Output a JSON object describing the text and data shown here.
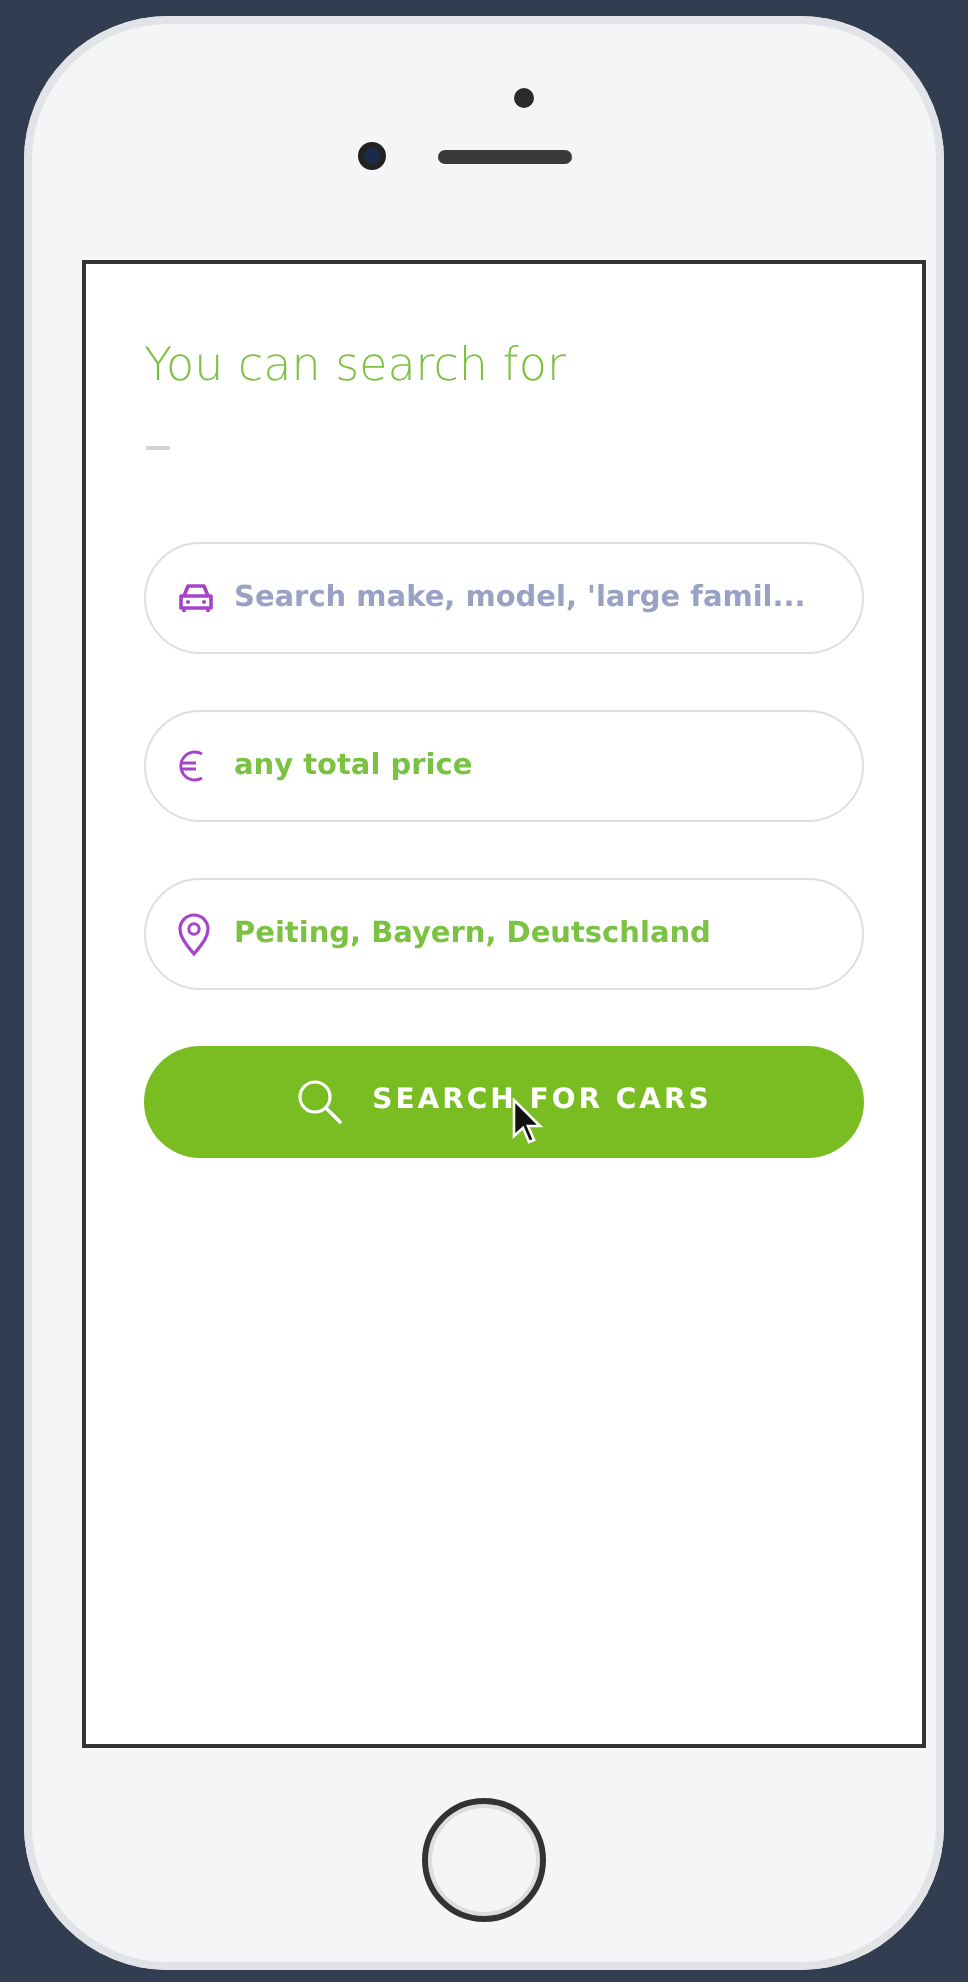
{
  "heading": "You can search for",
  "fields": [
    {
      "kind": "vehicle",
      "placeholder": "Search make, model, 'large famil..."
    },
    {
      "kind": "price",
      "value": "any total price"
    },
    {
      "kind": "location",
      "value": "Peiting, Bayern, Deutschland"
    }
  ],
  "search_button": {
    "label": "SEARCH FOR CARS"
  }
}
